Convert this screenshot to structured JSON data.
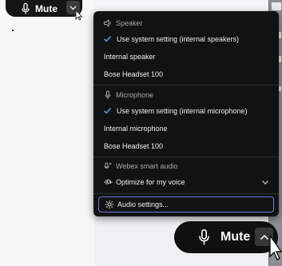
{
  "top_mute": {
    "label": "Mute",
    "icon": "microphone-icon",
    "chevron": "chevron-down-icon"
  },
  "menu": {
    "speaker_header": "Speaker",
    "speaker_options": [
      {
        "label": "Use system setting (internal speakers)",
        "checked": true
      },
      {
        "label": "Internal speaker",
        "checked": false
      },
      {
        "label": "Bose Headset 100",
        "checked": false
      }
    ],
    "microphone_header": "Microphone",
    "microphone_options": [
      {
        "label": "Use system setting (internal microphone)",
        "checked": true
      },
      {
        "label": "Internal microphone",
        "checked": false
      },
      {
        "label": "Bose Headset 100",
        "checked": false
      }
    ],
    "smart_audio_header": "Webex smart audio",
    "smart_audio_value": "Optimize for my voice",
    "audio_settings": "Audio settings..."
  },
  "bottom_mute": {
    "label": "Mute",
    "icon": "microphone-icon",
    "chevron": "chevron-up-icon"
  },
  "colors": {
    "menu_bg": "#121212",
    "focus_ring": "#6f79e6",
    "check": "#5aa9ff"
  }
}
